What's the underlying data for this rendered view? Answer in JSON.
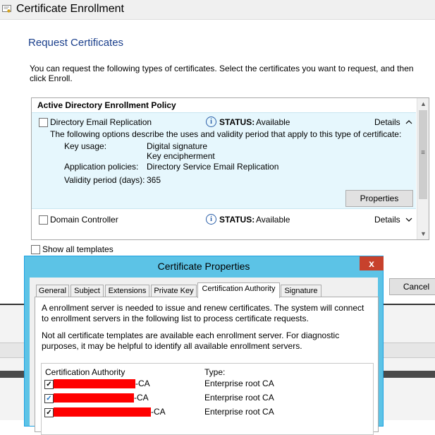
{
  "window": {
    "title": "Certificate Enrollment",
    "heading": "Request Certificates",
    "description": "You can request the following types of certificates. Select the certificates you want to request, and then click Enroll."
  },
  "list": {
    "policy_header": "Active Directory Enrollment Policy",
    "items": [
      {
        "name": "Directory Email Replication",
        "status_label": "STATUS:",
        "status_value": "Available",
        "details_label": "Details",
        "expanded": true,
        "intro": "The following options describe the uses and validity period that apply to this type of certificate:",
        "key_usage_label": "Key usage:",
        "key_usage_values": [
          "Digital signature",
          "Key encipherment"
        ],
        "app_policies_label": "Application policies:",
        "app_policies_value": "Directory Service Email Replication",
        "validity_label": "Validity period (days):",
        "validity_value": "365",
        "properties_button": "Properties"
      },
      {
        "name": "Domain Controller",
        "status_label": "STATUS:",
        "status_value": "Available",
        "details_label": "Details",
        "expanded": false
      }
    ]
  },
  "show_all_templates": "Show all templates",
  "cancel_button": "Cancel",
  "dialog": {
    "title": "Certificate Properties",
    "close_glyph": "x",
    "tabs": [
      "General",
      "Subject",
      "Extensions",
      "Private Key",
      "Certification Authority",
      "Signature"
    ],
    "active_tab": "Certification Authority",
    "paragraph1": "A enrollment server is needed to issue and renew certificates. The system will connect to enrollment servers in the following list to process certificate requests.",
    "paragraph2": "Not all certificate templates are available each enrollment server. For diagnostic purposes, it may be helpful to identify all available enrollment servers.",
    "ca_header": "Certification Authority",
    "type_header": "Type:",
    "ca_rows": [
      {
        "suffix": "-CA",
        "type": "Enterprise root CA",
        "checked": true
      },
      {
        "suffix": "-CA",
        "type": "Enterprise root CA",
        "checked": true
      },
      {
        "suffix": "-CA",
        "type": "Enterprise root CA",
        "checked": true
      }
    ]
  },
  "colors": {
    "heading_blue": "#1a3f8c",
    "selection_bg": "#e6f7fd",
    "dialog_frame": "#5cc3e6",
    "close_red": "#c7412c",
    "redaction": "#ff0000"
  }
}
